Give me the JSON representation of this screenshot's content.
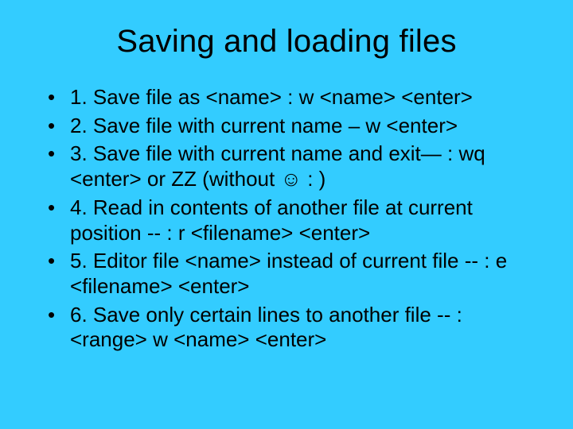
{
  "title": "Saving and loading files",
  "bullets": [
    "1. Save file as <name>  : w <name> <enter>",
    "2. Save file with current name – w <enter>",
    "3. Save file with current name and exit— : wq <enter> or ZZ (without ☺ : )",
    "4. Read in contents of another file at current position -- : r <filename> <enter>",
    "5. Editor file <name> instead of current file -- : e <filename> <enter>",
    "6. Save only certain lines to another file -- : <range> w <name> <enter>"
  ]
}
